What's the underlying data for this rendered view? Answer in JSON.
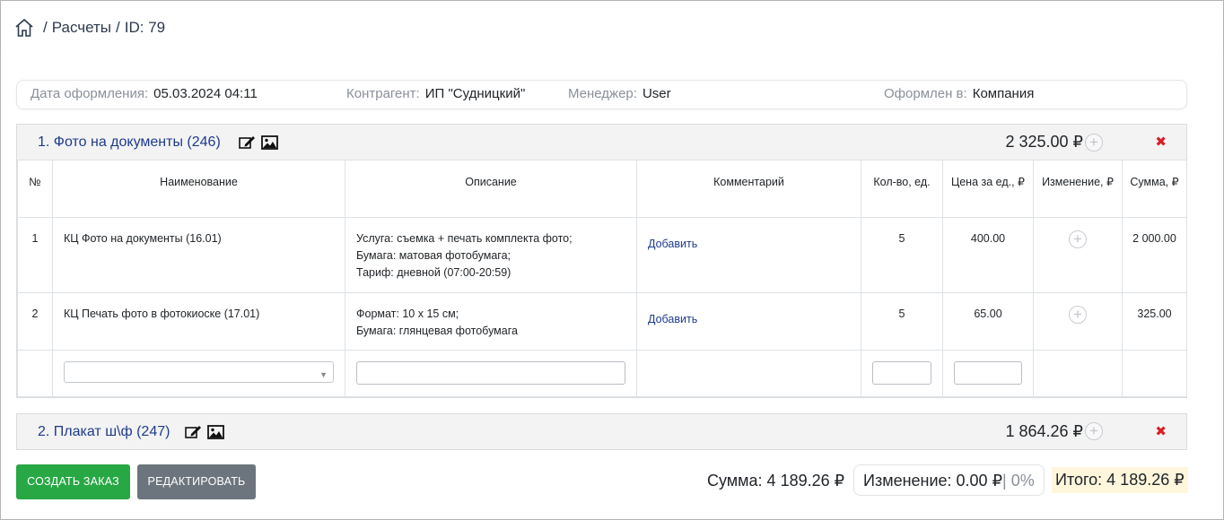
{
  "breadcrumb": {
    "home_icon": "home-icon",
    "section": "Расчеты",
    "sep": "/",
    "id_label": "ID: 79"
  },
  "info": {
    "date_label": "Дата оформления:",
    "date_value": "05.03.2024 04:11",
    "contractor_label": "Контрагент:",
    "contractor_value": "ИП \"Судницкий\"",
    "manager_label": "Менеджер:",
    "manager_value": "User",
    "issued_label": "Оформлен в:",
    "issued_value": "Компания"
  },
  "table_headers": {
    "no": "№",
    "name": "Наименование",
    "desc": "Описание",
    "comment": "Комментарий",
    "qty": "Кол-во, ед.",
    "price": "Цена за ед., ₽",
    "change": "Изменение, ₽",
    "sum": "Сумма, ₽"
  },
  "groups": [
    {
      "title": "1. Фото на документы (246)",
      "sum": "2 325.00 ₽",
      "close": "✖",
      "rows": [
        {
          "no": "1",
          "name": "КЦ Фото на документы (16.01)",
          "desc1": "Услуга: съемка + печать комплекта фото;",
          "desc2": "Бумага: матовая фотобумага;",
          "desc3": "Тариф: дневной (07:00-20:59)",
          "comment": "Добавить",
          "qty": "5",
          "price": "400.00",
          "sum": "2 000.00"
        },
        {
          "no": "2",
          "name": "КЦ Печать фото в фотокиоске (17.01)",
          "desc1": "Формат: 10 х 15 см;",
          "desc2": "Бумага: глянцевая фотобумага",
          "comment": "Добавить",
          "qty": "5",
          "price": "65.00",
          "sum": "325.00"
        }
      ]
    },
    {
      "title": "2. Плакат ш\\ф (247)",
      "sum": "1 864.26 ₽",
      "close": "✖"
    }
  ],
  "buttons": {
    "create": "СОЗДАТЬ ЗАКАЗ",
    "edit": "РЕДАКТИРОВАТЬ"
  },
  "totals": {
    "sum": "Сумма: 4 189.26 ₽",
    "change_value": "Изменение: 0.00 ₽",
    "change_percent": "| 0%",
    "final": "Итого: 4 189.26 ₽"
  },
  "colors": {
    "link": "#1f3b8c",
    "green_button": "#28a745",
    "grey_button": "#6c757d",
    "close": "#d81f26",
    "final_highlight": "#fff6dc"
  }
}
